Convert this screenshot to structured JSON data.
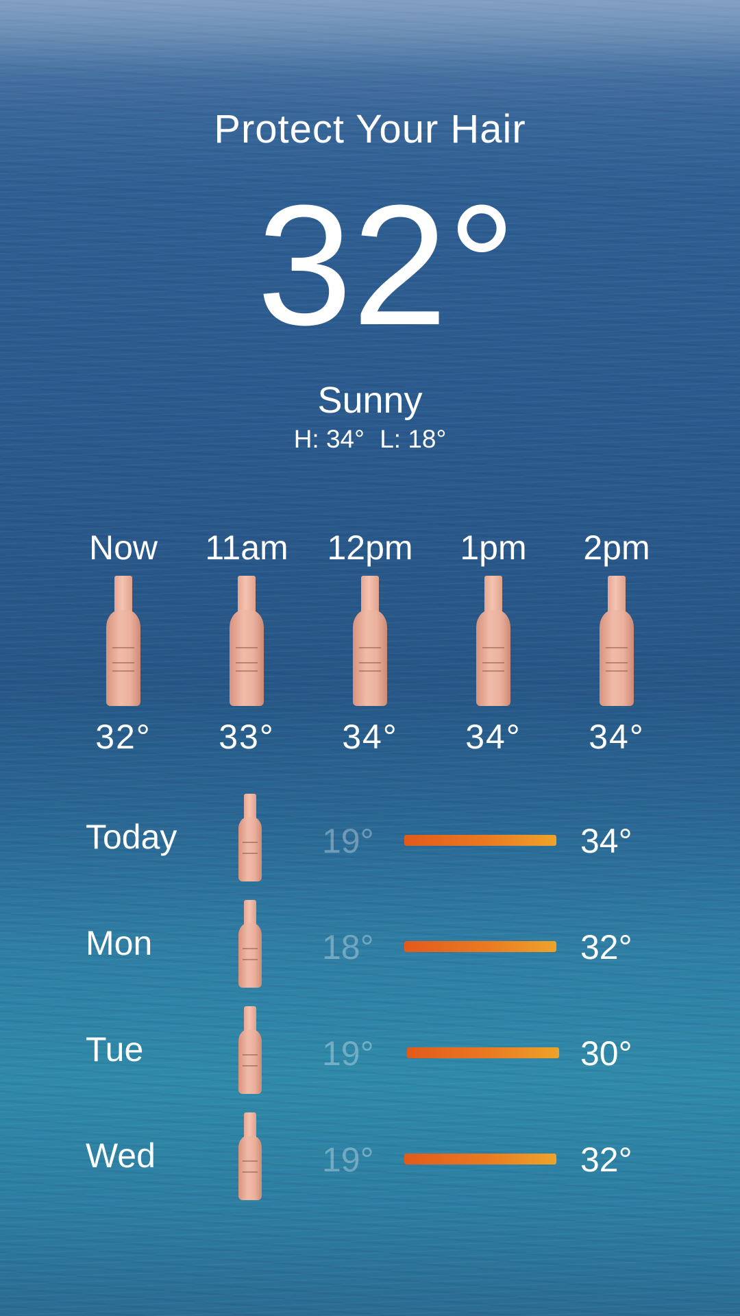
{
  "header": {
    "title": "Protect Your Hair",
    "temperature": "32°",
    "condition": "Sunny",
    "high": "H: 34°",
    "low": "L: 18°"
  },
  "hourly": [
    {
      "time": "Now",
      "temp": "32°",
      "icon": "hair-spray-bottle-icon"
    },
    {
      "time": "11am",
      "temp": "33°",
      "icon": "hair-spray-bottle-icon"
    },
    {
      "time": "12pm",
      "temp": "34°",
      "icon": "hair-spray-bottle-icon"
    },
    {
      "time": "1pm",
      "temp": "34°",
      "icon": "hair-spray-bottle-icon"
    },
    {
      "time": "2pm",
      "temp": "34°",
      "icon": "hair-spray-bottle-icon"
    }
  ],
  "daily": [
    {
      "day": "Today",
      "low": "19°",
      "high": "34°",
      "icon": "hair-spray-bottle-icon"
    },
    {
      "day": "Mon",
      "low": "18°",
      "high": "32°",
      "icon": "hair-spray-bottle-icon"
    },
    {
      "day": "Tue",
      "low": "19°",
      "high": "30°",
      "icon": "hair-spray-bottle-icon"
    },
    {
      "day": "Wed",
      "low": "19°",
      "high": "32°",
      "icon": "hair-spray-bottle-icon"
    }
  ],
  "colors": {
    "bar_start": "#e25a1c",
    "bar_end": "#eca42a",
    "bottle": "#eab19d"
  }
}
